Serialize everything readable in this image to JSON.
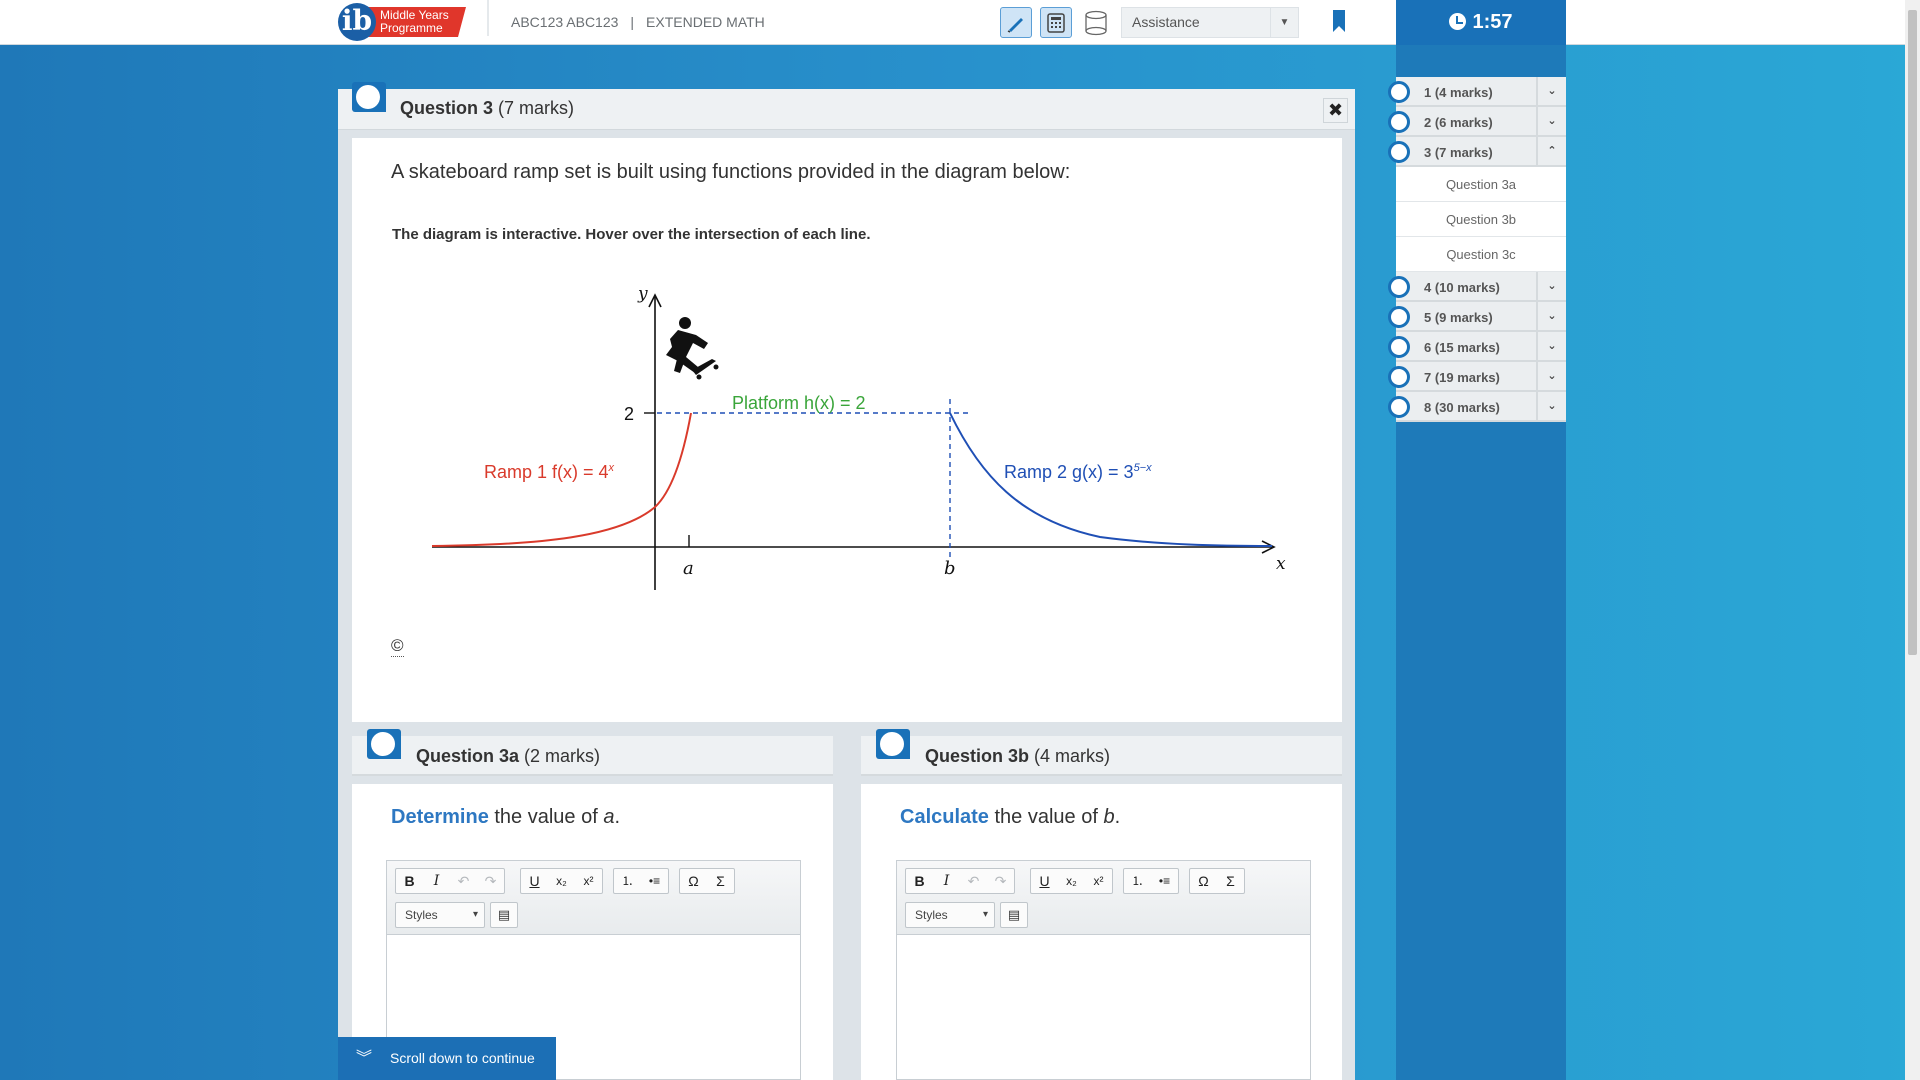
{
  "header": {
    "logo_glyph": "ib",
    "logo_line1": "Middle Years",
    "logo_line2": "Programme",
    "course_code": "ABC123 ABC123",
    "separator": "|",
    "course_name": "EXTENDED MATH",
    "assistance_label": "Assistance",
    "timer": "1:57"
  },
  "nav": {
    "items": [
      {
        "label": "1 (4 marks)",
        "chev": "⌄"
      },
      {
        "label": "2 (6 marks)",
        "chev": "⌄"
      },
      {
        "label": "3 (7 marks)",
        "chev": "⌃"
      },
      {
        "label": "4 (10 marks)",
        "chev": "⌄"
      },
      {
        "label": "5 (9 marks)",
        "chev": "⌄"
      },
      {
        "label": "6 (15 marks)",
        "chev": "⌄"
      },
      {
        "label": "7 (19 marks)",
        "chev": "⌄"
      },
      {
        "label": "8 (30 marks)",
        "chev": "⌄"
      }
    ],
    "subitems": [
      "Question 3a",
      "Question 3b",
      "Question 3c"
    ]
  },
  "question": {
    "title": "Question 3",
    "marks": "(7 marks)",
    "close": "✖",
    "intro": "A skateboard ramp set is built using functions provided in the diagram below:",
    "interactive_note": "The diagram is interactive. Hover over the intersection of each line.",
    "copyright": "©"
  },
  "diagram": {
    "y_axis": "y",
    "x_axis": "x",
    "tick_2": "2",
    "tick_a": "a",
    "tick_b": "b",
    "platform_label": "Platform h(x) = 2",
    "ramp1_label": "Ramp 1 f(x) = 4",
    "ramp1_exp": "x",
    "ramp2_label": "Ramp 2 g(x) = 3",
    "ramp2_exp": "5−x",
    "colors": {
      "ramp1": "#d93a2b",
      "platform": "#3aa53a",
      "ramp2": "#1f4fb5"
    }
  },
  "sub_a": {
    "title": "Question 3a",
    "marks": "(2 marks)",
    "cmd": "Determine",
    "rest": " the value of ",
    "var": "a",
    "end": "."
  },
  "sub_b": {
    "title": "Question 3b",
    "marks": "(4 marks)",
    "cmd": "Calculate",
    "rest": " the value of ",
    "var": "b",
    "end": "."
  },
  "editor": {
    "bold": "B",
    "italic": "I",
    "undo": "↶",
    "redo": "↷",
    "underline": "U",
    "subscript": "x₂",
    "superscript": "x²",
    "numbered_list": "⒈",
    "bullet_list": "•≡",
    "omega": "Ω",
    "sigma": "Σ",
    "styles": "Styles",
    "source": "▤"
  },
  "scroll_cta": "Scroll down to continue"
}
